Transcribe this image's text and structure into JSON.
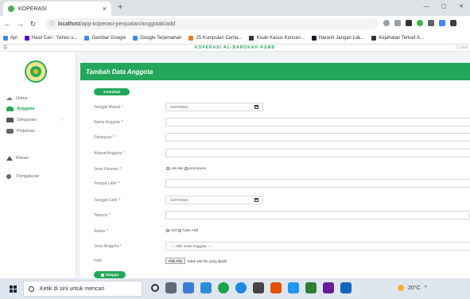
{
  "browser": {
    "tab_title": "KOPERASI",
    "tab_close": "×",
    "new_tab": "+",
    "url_host": "localhost",
    "url_path": "/app-koperasi-penjualan/anggotak/add",
    "bookmarks": [
      {
        "label": "Apl",
        "color": "#4285f4"
      },
      {
        "label": "Hasil Cari : Yahoo u...",
        "color": "#6001d2"
      },
      {
        "label": "Gambar Google",
        "color": "#4285f4"
      },
      {
        "label": "Google Terjemahan",
        "color": "#4285f4"
      },
      {
        "label": "25 Kumpulan Cerita...",
        "color": "#e67e22"
      },
      {
        "label": "Kisah Kasus Kencan...",
        "color": "#333333"
      },
      {
        "label": "Haram! Jangan Lak...",
        "color": "#1a1a2e"
      },
      {
        "label": "Kejahatan Terkait A...",
        "color": "#333333"
      }
    ]
  },
  "app": {
    "brand": "KOPERASI AL-BAROKAH RSMB",
    "search_hint": "Q Sear",
    "accent_color": "#23a85b"
  },
  "sidebar": {
    "items": [
      {
        "label": "Home",
        "icon": "home-icon"
      },
      {
        "label": "Anggota",
        "icon": "users-icon"
      },
      {
        "label": "Simpanan",
        "icon": "wallet-icon",
        "chevron": "›"
      },
      {
        "label": "Pinjaman",
        "icon": "handshake-icon"
      },
      {
        "label": "Rekan",
        "icon": "building-icon"
      },
      {
        "label": "Pengaturan",
        "icon": "gear-icon"
      }
    ]
  },
  "form": {
    "title": "Tambah Data Anggota",
    "back_button": "◂ Kembali",
    "submit_button": "Simpan",
    "fields": {
      "tanggal_masuk": {
        "label": "Tanggal Masuk *",
        "value": "21/07/2021"
      },
      "nama": {
        "label": "Nama Anggota *"
      },
      "pekerjaan": {
        "label": "Pekerjaan *"
      },
      "alamat": {
        "label": "Alamat Anggota *"
      },
      "jenis_kelamin": {
        "label": "Jenis Kelamin *",
        "opt1": "Laki-laki",
        "opt2": "perempuan"
      },
      "tempat_lahir": {
        "label": "Tempat Lahir *"
      },
      "tanggal_lahir": {
        "label": "Tanggal Lahir *",
        "value": "21/07/2021"
      },
      "telepon": {
        "label": "Telepon *"
      },
      "status": {
        "label": "Status *",
        "opt1": "Aktif",
        "opt2": "Tidak Aktif"
      },
      "jenis_anggota": {
        "label": "Jenis Anggota *",
        "placeholder": "---- Pilih Jenis Anggota ----"
      },
      "foto": {
        "label": "Foto",
        "button": "Pilih File",
        "no_file": "Tidak ada file yang dipilih"
      }
    }
  },
  "taskbar": {
    "search_placeholder": "Ketik di sini untuk mencari",
    "weather": "20°C",
    "tray_chevron": "^"
  }
}
